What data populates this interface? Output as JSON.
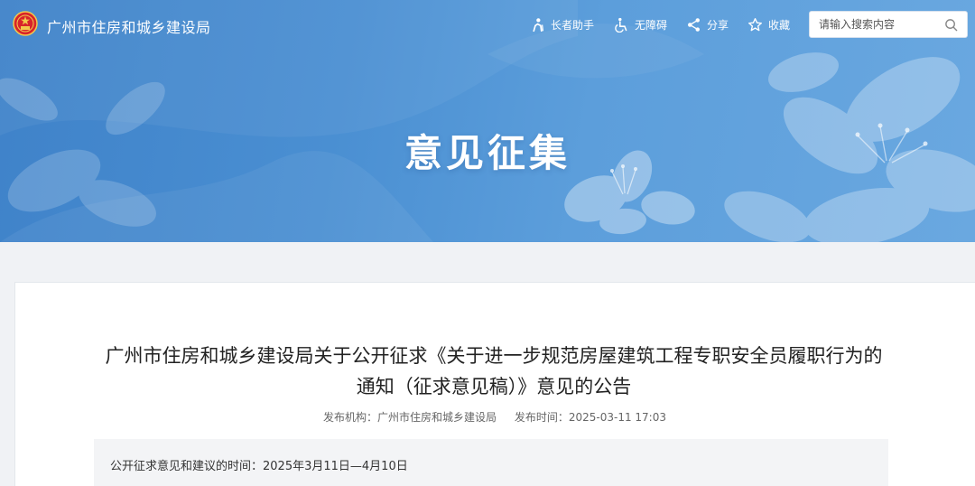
{
  "header": {
    "site_title": "广州市住房和城乡建设局",
    "tools": [
      {
        "label": "长者助手",
        "icon": "elder-assist-icon"
      },
      {
        "label": "无障碍",
        "icon": "wheelchair-icon"
      },
      {
        "label": "分享",
        "icon": "share-icon"
      },
      {
        "label": "收藏",
        "icon": "star-icon"
      }
    ],
    "search": {
      "placeholder": "请输入搜索内容",
      "icon": "search-icon"
    }
  },
  "banner": {
    "title": "意见征集"
  },
  "article": {
    "title_line1": "广州市住房和城乡建设局关于公开征求《关于进一步规范房屋建筑工程专职安全员履职行为的",
    "title_line2": "通知（征求意见稿）》意见的公告",
    "publisher_label": "发布机构：广州市住房和城乡建设局",
    "publish_time_label": "发布时间：2025-03-11 17:03",
    "notice": "公开征求意见和建议的时间：2025年3月11日—4月10日"
  },
  "colors": {
    "banner_primary": "#4a8fd2",
    "page_bg": "#f0f2f5",
    "text_dark": "#222222"
  }
}
